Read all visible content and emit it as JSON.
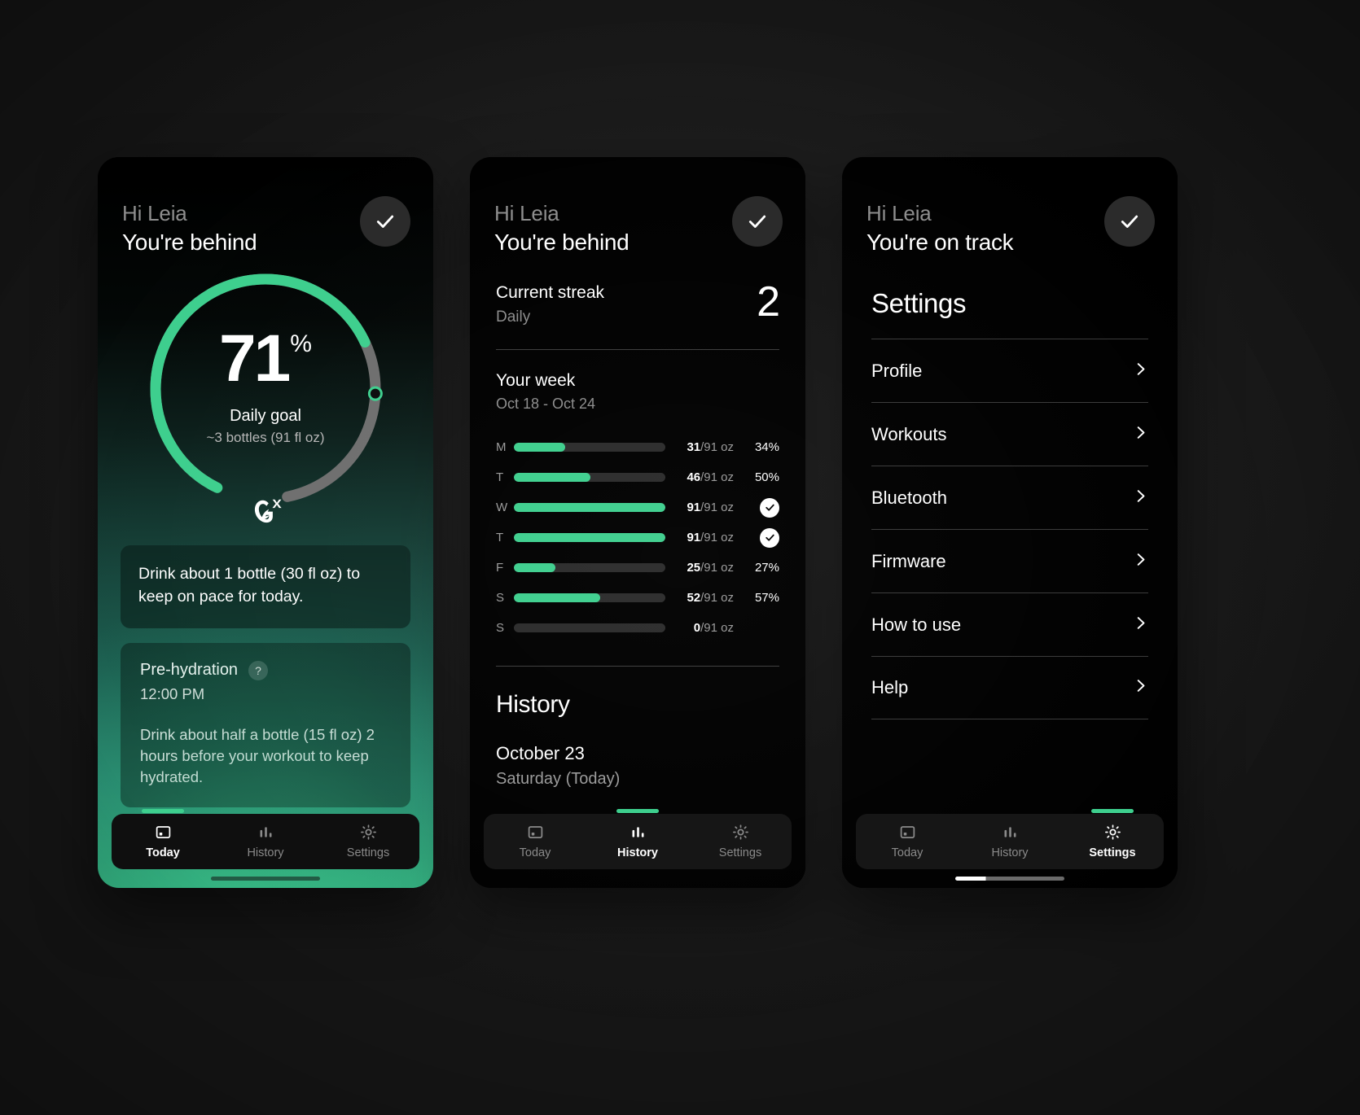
{
  "accent": "#3ECF8E",
  "phones": [
    {
      "id": "today",
      "greeting": "Hi Leia",
      "status": "You're behind",
      "ring": {
        "percent_value": "71",
        "percent_symbol": "%",
        "goal_label": "Daily goal",
        "goal_sub": "~3 bottles (91 fl oz)",
        "progress": 71,
        "brand_icon": "gx-logo-icon"
      },
      "tip": "Drink about 1 bottle (30 fl oz) to keep on pace for today.",
      "prehydration": {
        "title": "Pre-hydration",
        "help": "?",
        "time": "12:00 PM",
        "body": "Drink about half a bottle (15 fl oz) 2 hours before your workout to keep hydrated."
      },
      "nav": [
        {
          "label": "Today",
          "icon": "today-card-icon",
          "active": true
        },
        {
          "label": "History",
          "icon": "bar-chart-icon",
          "active": false
        },
        {
          "label": "Settings",
          "icon": "gear-icon",
          "active": false
        }
      ]
    },
    {
      "id": "history",
      "greeting": "Hi Leia",
      "status": "You're behind",
      "streak": {
        "title": "Current streak",
        "subtitle": "Daily",
        "value": "2"
      },
      "week": {
        "title": "Your week",
        "range": "Oct 18 - Oct 24"
      },
      "history": {
        "title": "History",
        "date": "October 23",
        "day": "Saturday (Today)"
      },
      "nav": [
        {
          "label": "Today",
          "icon": "today-card-icon",
          "active": false
        },
        {
          "label": "History",
          "icon": "bar-chart-icon",
          "active": true
        },
        {
          "label": "Settings",
          "icon": "gear-icon",
          "active": false
        }
      ]
    },
    {
      "id": "settings",
      "greeting": "Hi Leia",
      "status": "You're on track",
      "settings_title": "Settings",
      "settings_items": [
        {
          "label": "Profile"
        },
        {
          "label": "Workouts"
        },
        {
          "label": "Bluetooth"
        },
        {
          "label": "Firmware"
        },
        {
          "label": "How to use"
        },
        {
          "label": "Help"
        }
      ],
      "nav": [
        {
          "label": "Today",
          "icon": "today-card-icon",
          "active": false
        },
        {
          "label": "History",
          "icon": "bar-chart-icon",
          "active": false
        },
        {
          "label": "Settings",
          "icon": "gear-icon",
          "active": true
        }
      ]
    }
  ],
  "chart_data": {
    "type": "bar",
    "title": "Your week",
    "subtitle": "Oct 18 - Oct 24",
    "xlabel": "",
    "ylabel": "fl oz",
    "ylim": [
      0,
      91
    ],
    "goal": 91,
    "unit": "fl oz",
    "categories": [
      "M",
      "T",
      "W",
      "T",
      "F",
      "S",
      "S"
    ],
    "values": [
      31,
      46,
      91,
      91,
      25,
      52,
      0
    ],
    "percent_labels": [
      "34%",
      "50%",
      "",
      "",
      "27%",
      "57%",
      ""
    ],
    "goal_met": [
      false,
      false,
      true,
      true,
      false,
      false,
      false
    ],
    "value_labels": [
      "31/91 oz",
      "46/91 oz",
      "91/91 oz",
      "91/91 oz",
      "25/91 oz",
      "52/91 oz",
      "0/91 oz"
    ],
    "rows": [
      {
        "day": "M",
        "value": 31,
        "goal": 91,
        "value_label": "31",
        "goal_label": "/91 oz",
        "percent": "34%",
        "met": false
      },
      {
        "day": "T",
        "value": 46,
        "goal": 91,
        "value_label": "46",
        "goal_label": "/91 oz",
        "percent": "50%",
        "met": false
      },
      {
        "day": "W",
        "value": 91,
        "goal": 91,
        "value_label": "91",
        "goal_label": "/91 oz",
        "percent": "",
        "met": true
      },
      {
        "day": "T",
        "value": 91,
        "goal": 91,
        "value_label": "91",
        "goal_label": "/91 oz",
        "percent": "",
        "met": true
      },
      {
        "day": "F",
        "value": 25,
        "goal": 91,
        "value_label": "25",
        "goal_label": "/91 oz",
        "percent": "27%",
        "met": false
      },
      {
        "day": "S",
        "value": 52,
        "goal": 91,
        "value_label": "52",
        "goal_label": "/91 oz",
        "percent": "57%",
        "met": false
      },
      {
        "day": "S",
        "value": 0,
        "goal": 91,
        "value_label": "0",
        "goal_label": "/91 oz",
        "percent": "",
        "met": false
      }
    ],
    "legend": [],
    "grid": false
  }
}
